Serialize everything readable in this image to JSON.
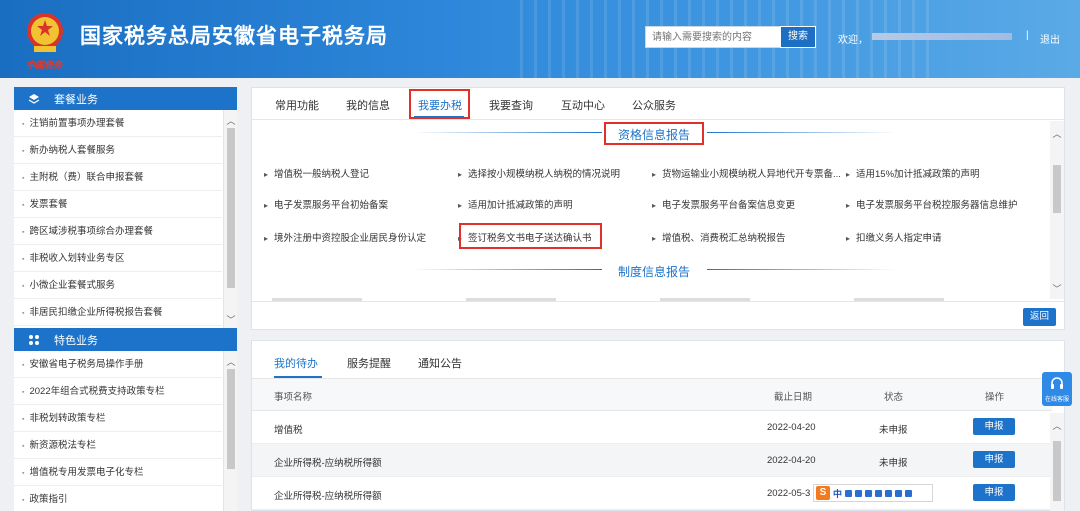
{
  "header": {
    "title": "国家税务总局安徽省电子税务局",
    "logo_text": "中国税务",
    "search_placeholder": "请输入需要搜索的内容",
    "search_button": "搜索",
    "welcome": "欢迎，",
    "separator": "|",
    "logout": "退出"
  },
  "sidebar": {
    "section1": {
      "title": "套餐业务",
      "items": [
        "注销前置事项办理套餐",
        "新办纳税人套餐服务",
        "主附税（费）联合申报套餐",
        "发票套餐",
        "跨区域涉税事项综合办理套餐",
        "非税收入划转业务专区",
        "小微企业套餐式服务",
        "非居民扣缴企业所得税报告套餐"
      ]
    },
    "section2": {
      "title": "特色业务",
      "items": [
        "安徽省电子税务局操作手册",
        "2022年组合式税费支持政策专栏",
        "非税划转政策专栏",
        "新资源税法专栏",
        "增值税专用发票电子化专栏",
        "政策指引"
      ]
    }
  },
  "main": {
    "tabs": [
      "常用功能",
      "我的信息",
      "我要办税",
      "我要查询",
      "互动中心",
      "公众服务"
    ],
    "active_tab": "我要办税",
    "section_title": "资格信息报告",
    "section_title2": "制度信息报告",
    "links": [
      [
        "增值税一般纳税人登记",
        "选择按小规模纳税人纳税的情况说明",
        "货物运输业小规模纳税人异地代开专票备...",
        "适用15%加计抵减政策的声明"
      ],
      [
        "电子发票服务平台初始备案",
        "适用加计抵减政策的声明",
        "电子发票服务平台备案信息变更",
        "电子发票服务平台税控服务器信息维护"
      ],
      [
        "境外注册中资控股企业居民身份认定",
        "签订税务文书电子送达确认书",
        "增值税、消费税汇总纳税报告",
        "扣缴义务人指定申请"
      ]
    ],
    "back_button": "返回"
  },
  "tasks": {
    "tabs": [
      "我的待办",
      "服务提醒",
      "通知公告"
    ],
    "active_tab": "我的待办",
    "columns": [
      "事项名称",
      "截止日期",
      "状态",
      "操作"
    ],
    "rows": [
      {
        "name": "增值税",
        "deadline": "2022-04-20",
        "status": "未申报",
        "action": "申报"
      },
      {
        "name": "企业所得税-应纳税所得额",
        "deadline": "2022-04-20",
        "status": "未申报",
        "action": "申报"
      },
      {
        "name": "企业所得税-应纳税所得额",
        "deadline": "2022-05-3",
        "status": "",
        "action": "申报"
      }
    ]
  },
  "ime": {
    "logo": "S",
    "mode": "中"
  },
  "float_service": {
    "label": "在线客服"
  },
  "colors": {
    "header_blue": "#1a6ec2",
    "accent_blue": "#1d73c9",
    "highlight_red": "#e0302a"
  }
}
